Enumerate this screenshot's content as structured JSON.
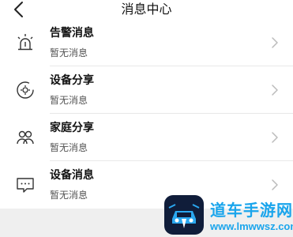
{
  "header": {
    "title": "消息中心",
    "back_icon": "chevron-left-icon"
  },
  "messages": [
    {
      "name": "告警消息",
      "status": "暂无消息",
      "icon": "alarm-siren-icon"
    },
    {
      "name": "设备分享",
      "status": "暂无消息",
      "icon": "device-share-icon"
    },
    {
      "name": "家庭分享",
      "status": "暂无消息",
      "icon": "family-share-icon"
    },
    {
      "name": "设备消息",
      "status": "暂无消息",
      "icon": "device-message-icon"
    }
  ],
  "watermark": {
    "text": "道车手游网",
    "url": "www.lmwwsz.com",
    "accent": "#1aa5ec"
  }
}
